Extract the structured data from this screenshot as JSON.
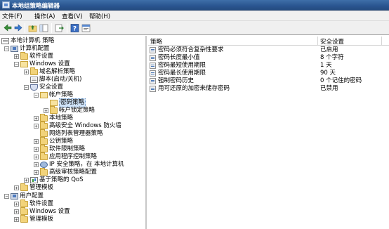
{
  "window": {
    "title": "本地组策略编辑器"
  },
  "menu": [
    {
      "label": "文件(F)"
    },
    {
      "label": "操作(A)"
    },
    {
      "label": "查看(V)"
    },
    {
      "label": "帮助(H)"
    }
  ],
  "toolbar": {
    "back_icon": "back-arrow-icon",
    "forward_icon": "forward-arrow-icon",
    "up_icon": "up-folder-icon",
    "show_hide_icon": "show-hide-tree-icon",
    "export_icon": "export-list-icon",
    "help_icon": "help-icon",
    "properties_icon": "properties-icon"
  },
  "tree": {
    "root": "本地计算机 策略",
    "items": [
      {
        "label": "计算机配置",
        "expander": "−",
        "icon": "computer"
      },
      {
        "label": "软件设置",
        "expander": "+",
        "icon": "folder"
      },
      {
        "label": "Windows 设置",
        "expander": "−",
        "icon": "folder-open"
      },
      {
        "label": "域名解析策略",
        "expander": "+",
        "icon": "folder"
      },
      {
        "label": "脚本(启动/关机)",
        "expander": "",
        "icon": "doc"
      },
      {
        "label": "安全设置",
        "expander": "−",
        "icon": "shield"
      },
      {
        "label": "帐户策略",
        "expander": "−",
        "icon": "folder-open"
      },
      {
        "label": "密码策略",
        "expander": "",
        "icon": "folder-open",
        "selected": true
      },
      {
        "label": "帐户锁定策略",
        "expander": "+",
        "icon": "folder"
      },
      {
        "label": "本地策略",
        "expander": "+",
        "icon": "folder"
      },
      {
        "label": "高级安全 Windows 防火墙",
        "expander": "+",
        "icon": "folder"
      },
      {
        "label": "网络列表管理器策略",
        "expander": "",
        "icon": "folder"
      },
      {
        "label": "公钥策略",
        "expander": "+",
        "icon": "folder"
      },
      {
        "label": "软件限制策略",
        "expander": "+",
        "icon": "folder"
      },
      {
        "label": "应用程序控制策略",
        "expander": "+",
        "icon": "folder"
      },
      {
        "label": "IP 安全策略，在 本地计算机",
        "expander": "+",
        "icon": "network"
      },
      {
        "label": "高级审核策略配置",
        "expander": "+",
        "icon": "folder"
      },
      {
        "label": "基于策略的 QoS",
        "expander": "+",
        "icon": "chart"
      },
      {
        "label": "管理模板",
        "expander": "+",
        "icon": "folder"
      },
      {
        "label": "用户配置",
        "expander": "−",
        "icon": "computer"
      },
      {
        "label": "软件设置",
        "expander": "+",
        "icon": "folder"
      },
      {
        "label": "Windows 设置",
        "expander": "+",
        "icon": "folder"
      },
      {
        "label": "管理模板",
        "expander": "+",
        "icon": "folder"
      }
    ]
  },
  "list": {
    "columns": [
      "策略",
      "安全设置"
    ],
    "rows": [
      {
        "policy": "密码必须符合复杂性要求",
        "setting": "已启用"
      },
      {
        "policy": "密码长度最小值",
        "setting": "8 个字符"
      },
      {
        "policy": "密码最短使用期限",
        "setting": "1 天"
      },
      {
        "policy": "密码最长使用期限",
        "setting": "90 天"
      },
      {
        "policy": "强制密码历史",
        "setting": "0 个记住的密码"
      },
      {
        "policy": "用可还原的加密来储存密码",
        "setting": "已禁用"
      }
    ]
  },
  "colors": {
    "titlebar": "#2a5590",
    "selection": "#cfe3f9"
  }
}
